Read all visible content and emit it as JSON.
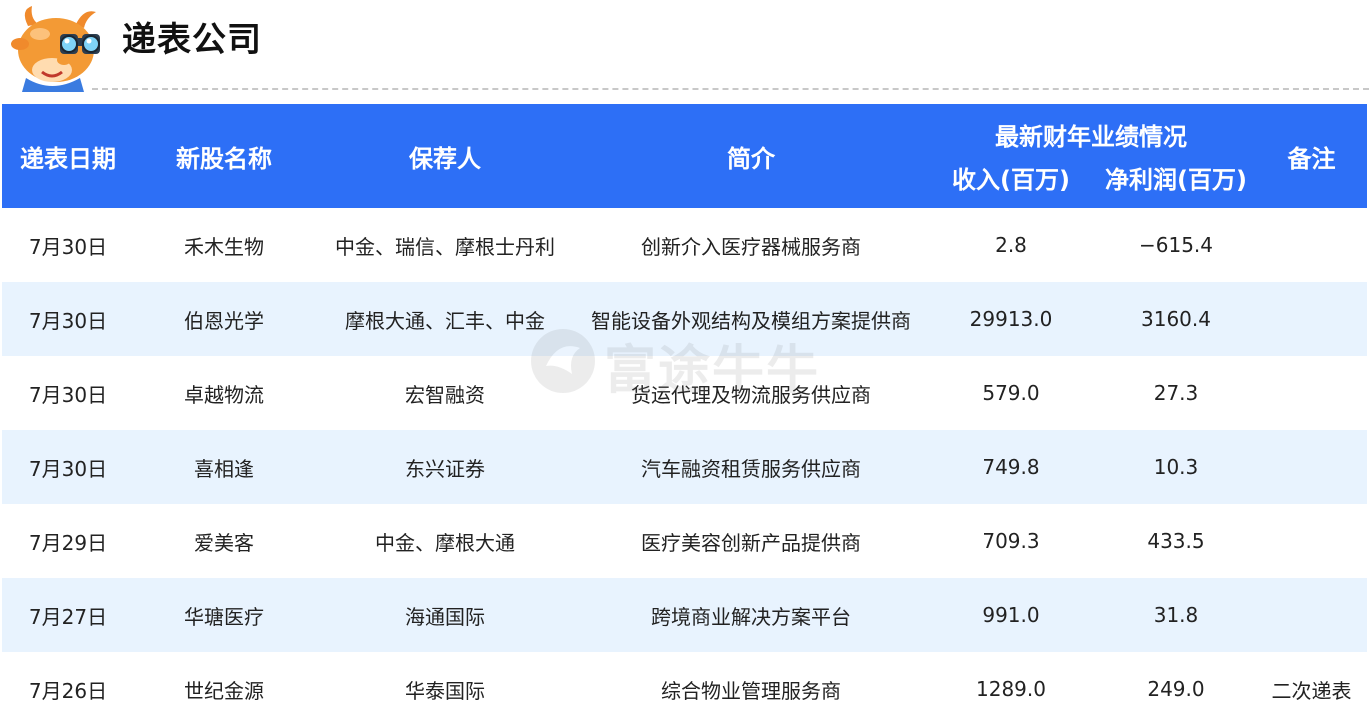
{
  "header": {
    "title": "递表公司",
    "mascot_icon": "cow-with-binoculars-icon"
  },
  "table": {
    "columns": {
      "date": "递表日期",
      "name": "新股名称",
      "sponsor": "保荐人",
      "intro": "简介",
      "performance_group": "最新财年业绩情况",
      "revenue": "收入(百万)",
      "net_profit": "净利润(百万)",
      "note": "备注"
    },
    "rows": [
      {
        "date": "7月30日",
        "name": "禾木生物",
        "sponsor": "中金、瑞信、摩根士丹利",
        "intro": "创新介入医疗器械服务商",
        "revenue": "2.8",
        "net_profit": "−615.4",
        "note": ""
      },
      {
        "date": "7月30日",
        "name": "伯恩光学",
        "sponsor": "摩根大通、汇丰、中金",
        "intro": "智能设备外观结构及模组方案提供商",
        "revenue": "29913.0",
        "net_profit": "3160.4",
        "note": ""
      },
      {
        "date": "7月30日",
        "name": "卓越物流",
        "sponsor": "宏智融资",
        "intro": "货运代理及物流服务供应商",
        "revenue": "579.0",
        "net_profit": "27.3",
        "note": ""
      },
      {
        "date": "7月30日",
        "name": "喜相逢",
        "sponsor": "东兴证券",
        "intro": "汽车融资租赁服务供应商",
        "revenue": "749.8",
        "net_profit": "10.3",
        "note": ""
      },
      {
        "date": "7月29日",
        "name": "爱美客",
        "sponsor": "中金、摩根大通",
        "intro": "医疗美容创新产品提供商",
        "revenue": "709.3",
        "net_profit": "433.5",
        "note": ""
      },
      {
        "date": "7月27日",
        "name": "华瑭医疗",
        "sponsor": "海通国际",
        "intro": "跨境商业解决方案平台",
        "revenue": "991.0",
        "net_profit": "31.8",
        "note": ""
      },
      {
        "date": "7月26日",
        "name": "世纪金源",
        "sponsor": "华泰国际",
        "intro": "综合物业管理服务商",
        "revenue": "1289.0",
        "net_profit": "249.0",
        "note": "二次递表"
      }
    ]
  },
  "watermark": {
    "text": "富途牛牛",
    "icon": "futu-logo-icon"
  },
  "colors": {
    "header_bg": "#2d6ff6",
    "stripe_bg": "#e8f3fe"
  }
}
